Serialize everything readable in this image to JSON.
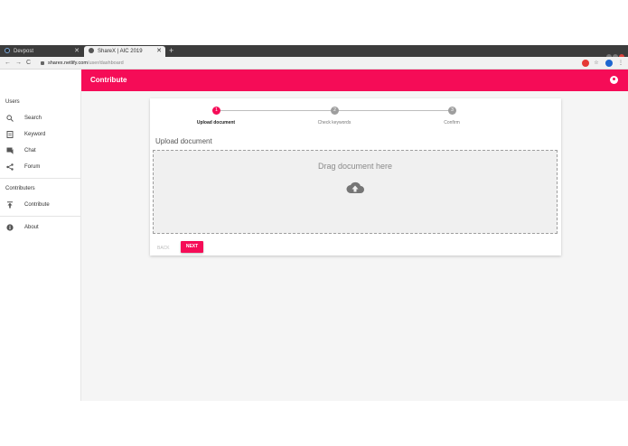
{
  "browser": {
    "tabs": [
      {
        "title": "Devpost"
      },
      {
        "title": "ShareX | AIC 2019"
      }
    ],
    "url_host": "sharex.netlify.com",
    "url_path": "/user/dashboard"
  },
  "app": {
    "header_title": "Contribute",
    "accent_color": "#f50c57"
  },
  "sidebar": {
    "sections": [
      {
        "title": "Users",
        "items": [
          {
            "label": "Search",
            "icon": "search-icon"
          },
          {
            "label": "Keyword",
            "icon": "document-icon"
          },
          {
            "label": "Chat",
            "icon": "chat-icon"
          },
          {
            "label": "Forum",
            "icon": "share-icon"
          }
        ]
      },
      {
        "title": "Contributers",
        "items": [
          {
            "label": "Contribute",
            "icon": "upload-icon"
          }
        ]
      }
    ],
    "about": {
      "label": "About",
      "icon": "info-icon"
    }
  },
  "stepper": {
    "steps": [
      {
        "number": "1",
        "label": "Upload document",
        "active": true
      },
      {
        "number": "2",
        "label": "Check keywords",
        "active": false
      },
      {
        "number": "3",
        "label": "Confirm",
        "active": false
      }
    ]
  },
  "upload": {
    "title": "Upload document",
    "drop_text": "Drag document here",
    "icon": "cloud-upload-icon"
  },
  "actions": {
    "back_label": "BACK",
    "next_label": "NEXT"
  }
}
